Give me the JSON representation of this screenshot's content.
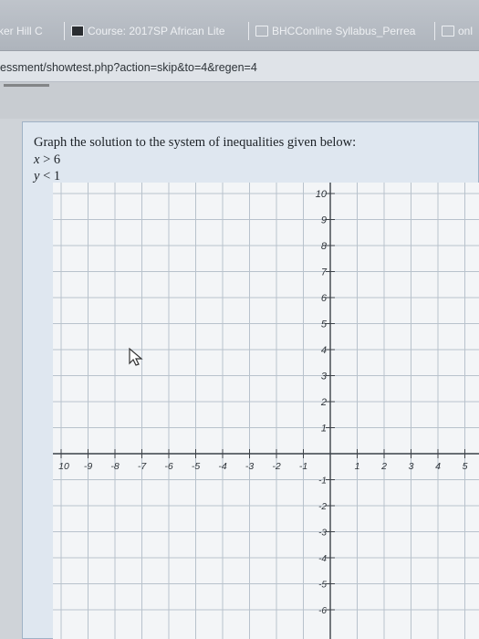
{
  "bookmarks": [
    {
      "label": "ker Hill C",
      "icon": "page-icon"
    },
    {
      "label": "Course: 2017SP African Lite",
      "icon": "bookmark-dark-icon"
    },
    {
      "label": "BHCConline Syllabus_Perrea",
      "icon": "page-icon"
    },
    {
      "label": "onl",
      "icon": "page-icon"
    }
  ],
  "address_bar": {
    "url": "essment/showtest.php?action=skip&to=4&regen=4"
  },
  "question": {
    "prompt": "Graph the solution to the system of inequalities given below:",
    "inequality_1": {
      "var": "x",
      "op": ">",
      "value": "6"
    },
    "inequality_2": {
      "var": "y",
      "op": "<",
      "value": "1"
    }
  },
  "graph": {
    "x_tick_labels": [
      "10",
      "-9",
      "-8",
      "-7",
      "-6",
      "-5",
      "-4",
      "-3",
      "-2",
      "-1",
      "1",
      "2",
      "3",
      "4",
      "5"
    ],
    "y_tick_labels_pos": [
      "10",
      "9",
      "8",
      "7",
      "6",
      "5",
      "4",
      "3",
      "2",
      "1"
    ],
    "y_tick_labels_neg": [
      "-1",
      "-2",
      "-3",
      "-4",
      "-5",
      "-6"
    ],
    "x_range": [
      -10,
      5
    ],
    "y_range": [
      -6.5,
      10
    ],
    "grid": true
  }
}
